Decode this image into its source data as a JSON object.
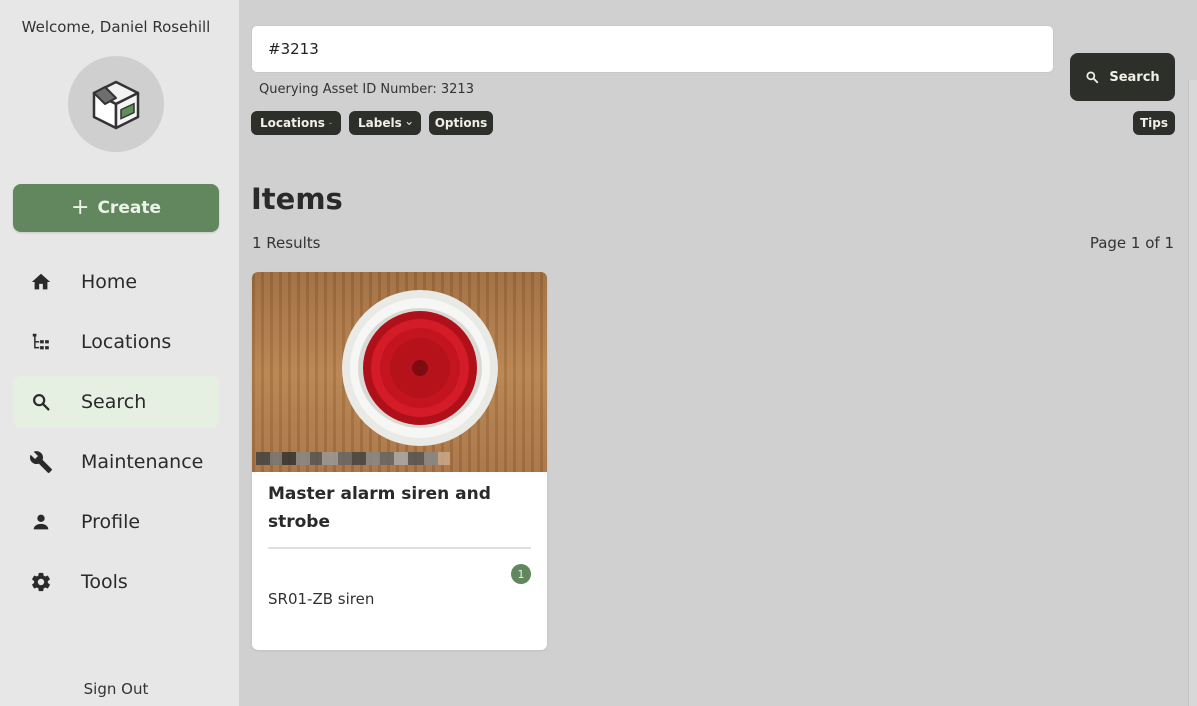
{
  "sidebar": {
    "welcome": "Welcome, Daniel Rosehill",
    "create_label": "Create",
    "nav": [
      {
        "label": "Home",
        "icon": "home-icon"
      },
      {
        "label": "Locations",
        "icon": "tree-icon"
      },
      {
        "label": "Search",
        "icon": "search-icon",
        "active": true
      },
      {
        "label": "Maintenance",
        "icon": "wrench-icon"
      },
      {
        "label": "Profile",
        "icon": "person-icon"
      },
      {
        "label": "Tools",
        "icon": "gear-icon"
      }
    ],
    "sign_out": "Sign Out"
  },
  "search": {
    "value": "#3213",
    "hint": "Querying Asset ID Number: 3213",
    "button_label": "Search"
  },
  "filters": {
    "locations": "Locations",
    "labels": "Labels",
    "options": "Options",
    "tips": "Tips"
  },
  "main": {
    "title": "Items",
    "results": "1 Results",
    "page": "Page 1 of 1"
  },
  "items": [
    {
      "name": "Master alarm siren and strobe",
      "quantity": "1",
      "description": "SR01-ZB siren"
    }
  ],
  "colors": {
    "accent_green": "#62875f",
    "dark_button": "#2d2f2a",
    "active_nav": "#e6f0e2"
  }
}
